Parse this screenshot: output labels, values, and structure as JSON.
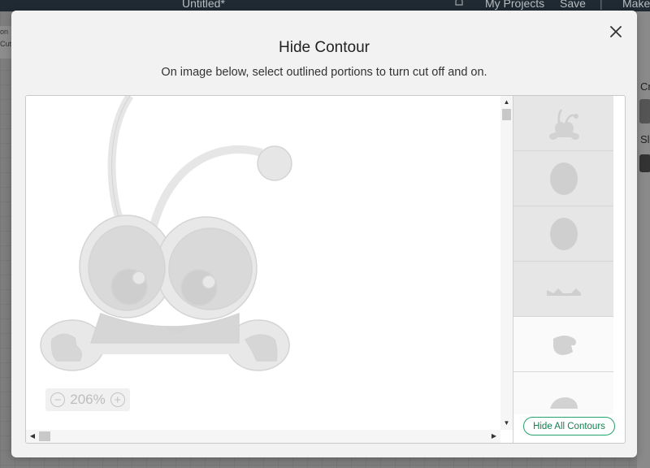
{
  "background_app": {
    "document_title": "Untitled*",
    "nav_my_projects": "My Projects",
    "nav_save": "Save",
    "nav_make": "Make",
    "left_panel_items": [
      "on",
      "Cut"
    ],
    "right_panel_label_1": "Cr",
    "right_panel_label_2": "Sli"
  },
  "modal": {
    "title": "Hide Contour",
    "subtitle": "On image below, select outlined portions to turn cut off and on.",
    "zoom_level": "206%",
    "hide_all_label": "Hide All Contours",
    "contour_tiles": [
      {
        "name": "whole-character",
        "state": "selected"
      },
      {
        "name": "left-eye",
        "state": "selected"
      },
      {
        "name": "right-eye",
        "state": "selected"
      },
      {
        "name": "mouth",
        "state": "selected"
      },
      {
        "name": "right-hand",
        "state": "unselected"
      },
      {
        "name": "left-hand",
        "state": "unselected"
      }
    ]
  },
  "colors": {
    "accent": "#24a36a",
    "contour_fill": "#e8e8e8",
    "contour_stroke": "#d4d4d4",
    "inner_fill": "#d6d6d6"
  }
}
